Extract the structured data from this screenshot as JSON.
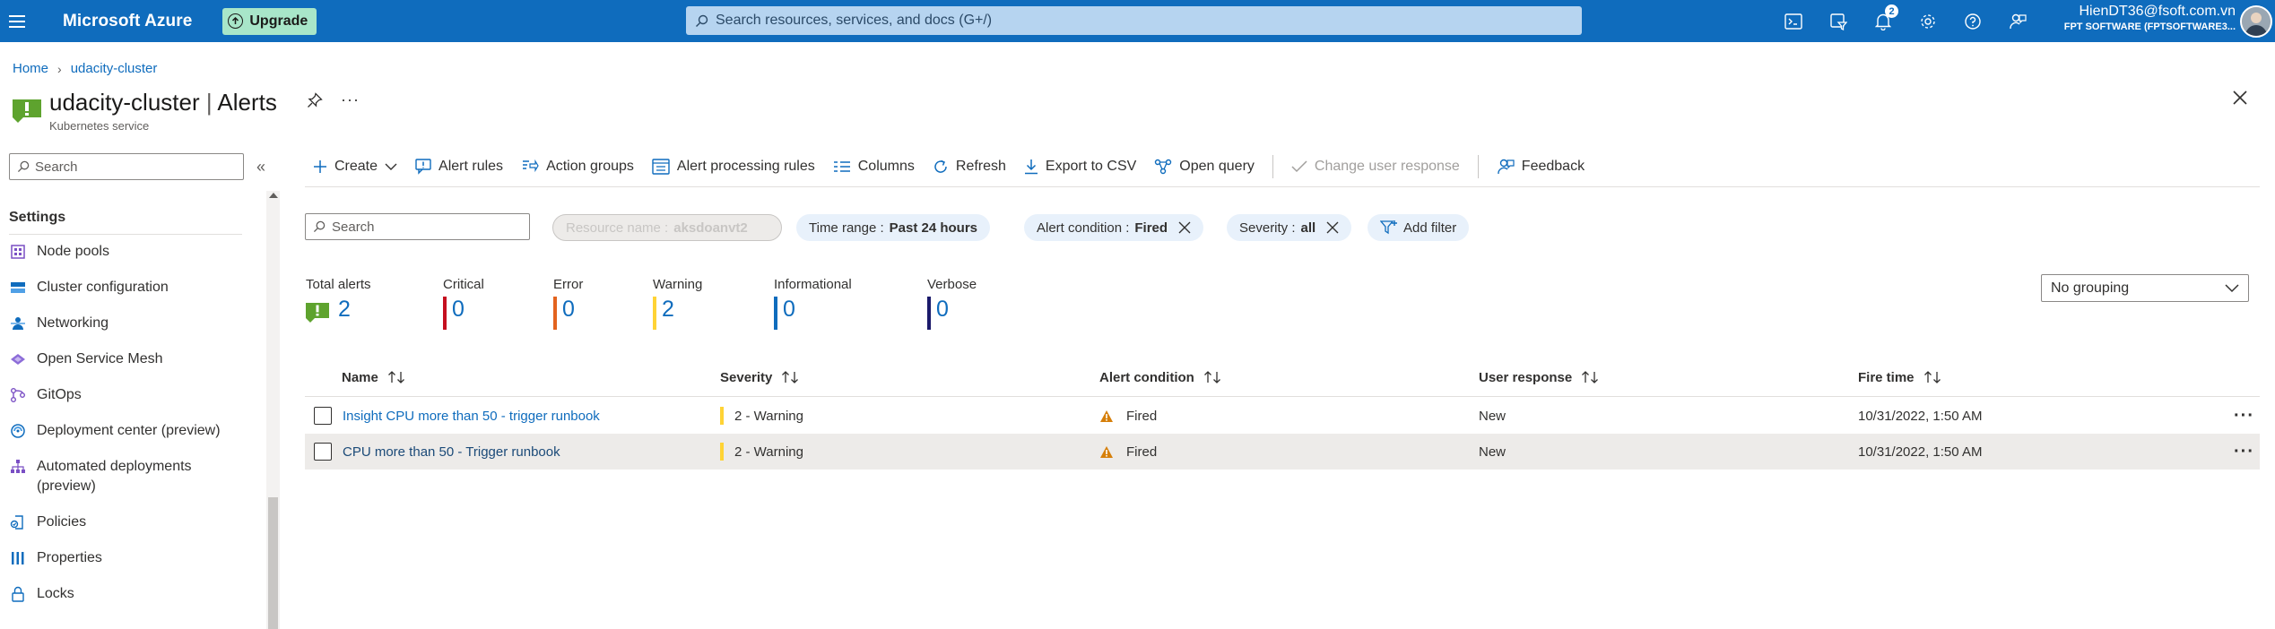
{
  "topbar": {
    "brand": "Microsoft Azure",
    "upgrade_label": "Upgrade",
    "search_placeholder": "Search resources, services, and docs (G+/)",
    "notification_count": "2",
    "account_email": "HienDT36@fsoft.com.vn",
    "account_tenant": "FPT SOFTWARE (FPTSOFTWARE3..."
  },
  "breadcrumb": {
    "home": "Home",
    "resource": "udacity-cluster"
  },
  "header": {
    "resource_name": "udacity-cluster",
    "separator": "|",
    "page": "Alerts",
    "subtitle": "Kubernetes service",
    "more": "···"
  },
  "sidebar": {
    "search_placeholder": "Search",
    "collapse": "«",
    "section_title": "Settings",
    "items": [
      {
        "label": "Node pools",
        "icon": "node-pools-icon"
      },
      {
        "label": "Cluster configuration",
        "icon": "cluster-configuration-icon"
      },
      {
        "label": "Networking",
        "icon": "networking-icon"
      },
      {
        "label": "Open Service Mesh",
        "icon": "open-service-mesh-icon"
      },
      {
        "label": "GitOps",
        "icon": "gitops-icon"
      },
      {
        "label": "Deployment center (preview)",
        "icon": "deployment-center-icon"
      },
      {
        "label": "Automated deployments",
        "label2": "(preview)",
        "icon": "automated-deployments-icon"
      },
      {
        "label": "Policies",
        "icon": "policies-icon"
      },
      {
        "label": "Properties",
        "icon": "properties-icon"
      },
      {
        "label": "Locks",
        "icon": "lock-icon"
      }
    ]
  },
  "toolbar": {
    "create": "Create",
    "alert_rules": "Alert rules",
    "action_groups": "Action groups",
    "alert_processing_rules": "Alert processing rules",
    "columns": "Columns",
    "refresh": "Refresh",
    "export_csv": "Export to CSV",
    "open_query": "Open query",
    "change_user_response": "Change user response",
    "feedback": "Feedback"
  },
  "filters": {
    "search_placeholder": "Search",
    "resource_name_label": "Resource name :",
    "resource_name_value": "aksdoanvt2",
    "time_range_label": "Time range :",
    "time_range_value": "Past 24 hours",
    "alert_condition_label": "Alert condition :",
    "alert_condition_value": "Fired",
    "severity_label": "Severity :",
    "severity_value": "all",
    "add_filter": "Add filter"
  },
  "summary": {
    "total": {
      "label": "Total alerts",
      "value": "2"
    },
    "critical": {
      "label": "Critical",
      "value": "0",
      "color": "#c50f1f"
    },
    "error": {
      "label": "Error",
      "value": "0",
      "color": "#e3631e"
    },
    "warning": {
      "label": "Warning",
      "value": "2",
      "color": "#ffd335"
    },
    "informational": {
      "label": "Informational",
      "value": "0",
      "color": "#0f6cbd"
    },
    "verbose": {
      "label": "Verbose",
      "value": "0",
      "color": "#1b1a6b"
    }
  },
  "grouping": {
    "value": "No grouping"
  },
  "table": {
    "columns": [
      "Name",
      "Severity",
      "Alert condition",
      "User response",
      "Fire time"
    ],
    "rows": [
      {
        "name": "Insight CPU more than 50 - trigger runbook",
        "severity": "2 - Warning",
        "condition": "Fired",
        "user_response": "New",
        "fire_time": "10/31/2022, 1:50 AM"
      },
      {
        "name": "CPU more than 50 - Trigger runbook",
        "severity": "2 - Warning",
        "condition": "Fired",
        "user_response": "New",
        "fire_time": "10/31/2022, 1:50 AM"
      }
    ],
    "row_more": "···"
  },
  "colors": {
    "azure_blue": "#0f6cbd",
    "upgrade_green": "#a8e6c9",
    "warning_yellow": "#ffd335",
    "fired_orange": "#d67f0a",
    "selected_row": "#edebe9"
  }
}
